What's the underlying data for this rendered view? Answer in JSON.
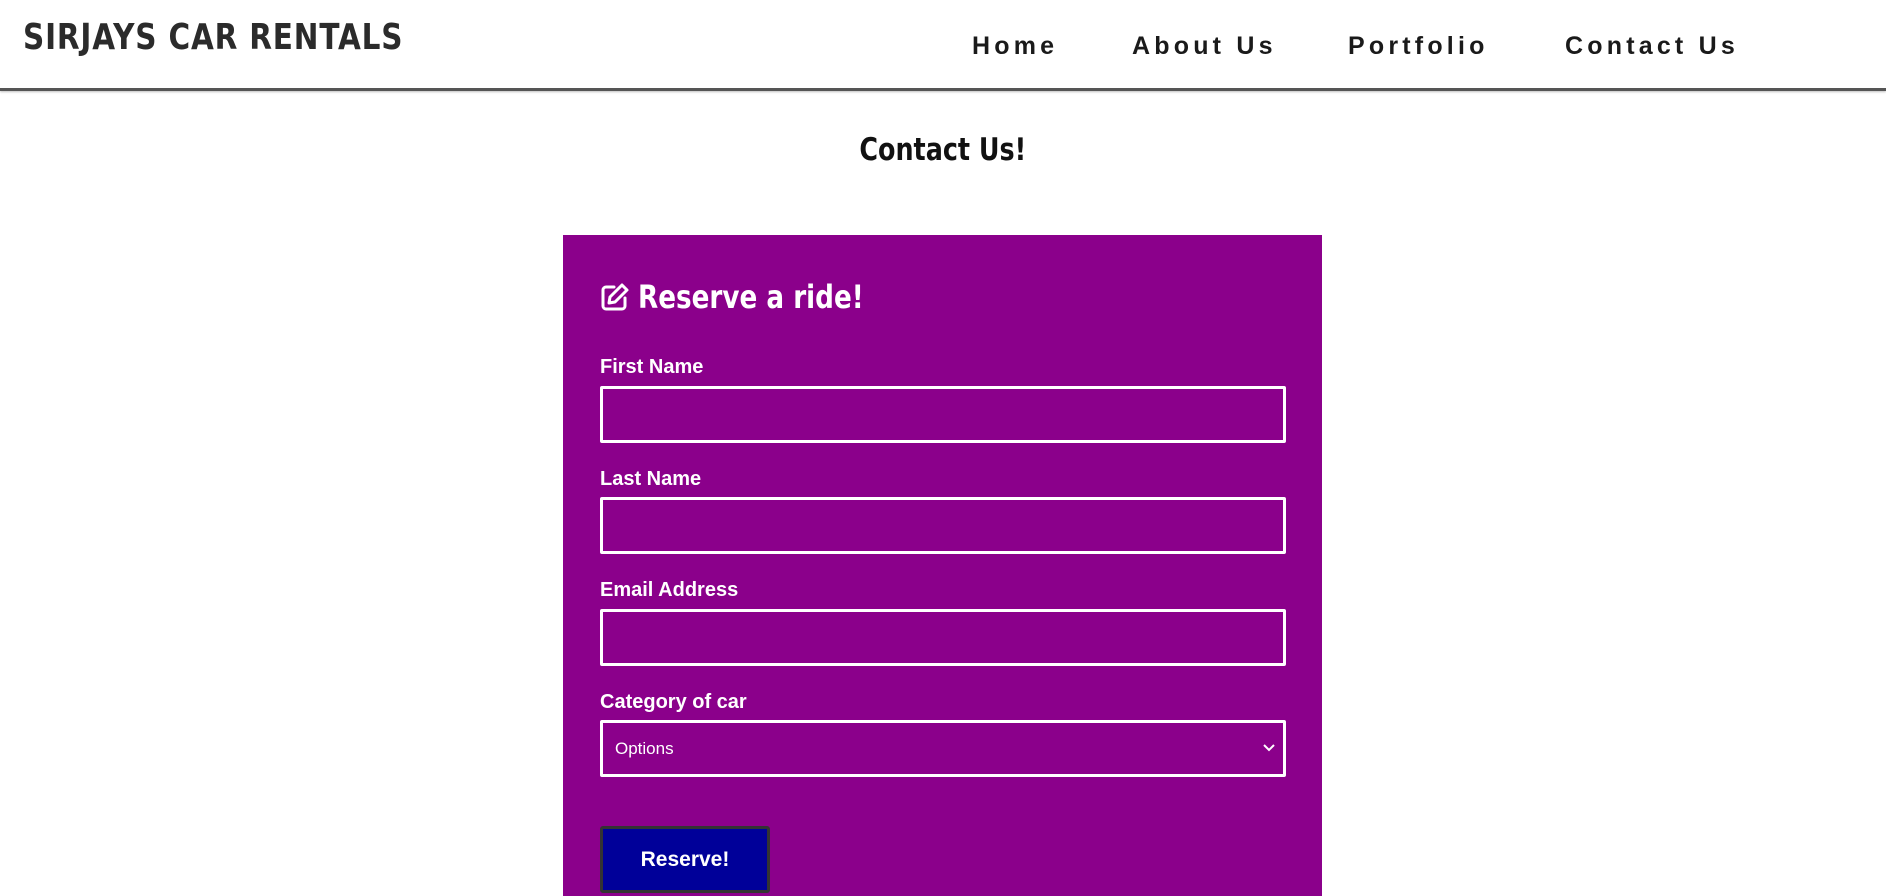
{
  "header": {
    "brand": "SIRJAYS CAR RENTALS",
    "nav": [
      {
        "label": "Home"
      },
      {
        "label": "About Us"
      },
      {
        "label": "Portfolio"
      },
      {
        "label": "Contact Us"
      }
    ]
  },
  "main": {
    "title": "Contact Us!"
  },
  "form": {
    "icon": "edit-icon",
    "title": "Reserve a ride!",
    "fields": [
      {
        "label": "First Name",
        "value": "",
        "placeholder": ""
      },
      {
        "label": "Last Name",
        "value": "",
        "placeholder": ""
      },
      {
        "label": "Email Address",
        "value": "",
        "placeholder": ""
      }
    ],
    "category": {
      "label": "Category of car",
      "selected": "Options"
    },
    "submit_label": "Reserve!"
  },
  "colors": {
    "panel": "#8b008b",
    "button": "#000099",
    "text_on_panel": "#ffffff",
    "header_border": "#555555"
  }
}
